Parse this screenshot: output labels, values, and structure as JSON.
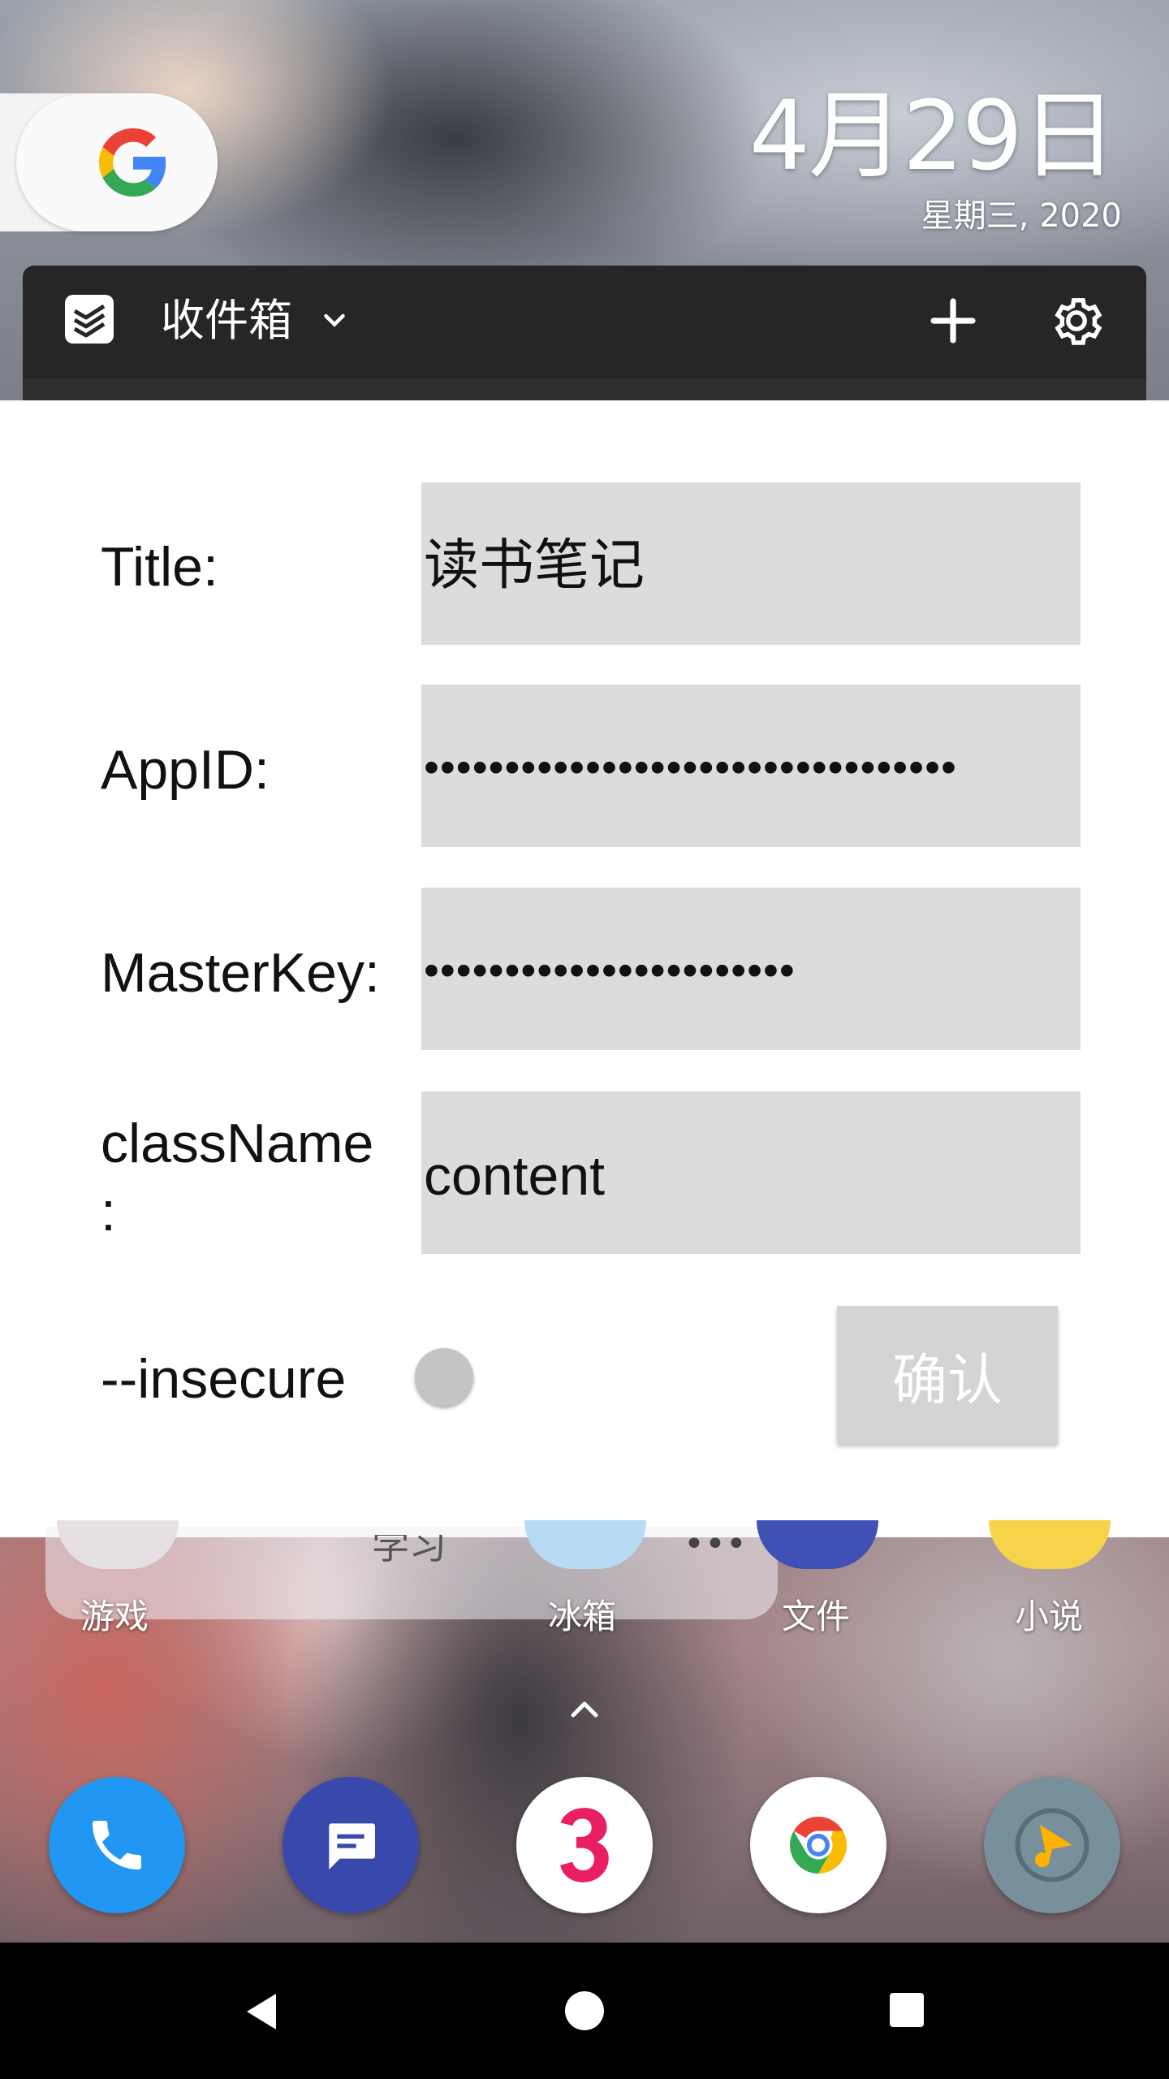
{
  "launcher": {
    "date": "4月29日",
    "weekday_year": "星期三, 2020"
  },
  "widget": {
    "list_name": "收件箱"
  },
  "form": {
    "title_label": "Title:",
    "title_value": "读书笔记",
    "appid_label": "AppID:",
    "appid_value": "•••••••••••••••••••••••••••••••••",
    "masterkey_label": "MasterKey:",
    "masterkey_value": "•••••••••••••••••••••••",
    "classname_label_line1": "className",
    "classname_label_line2": ":",
    "classname_value": "content",
    "insecure_label": "--insecure",
    "insecure_enabled": false,
    "confirm_label": "确认"
  },
  "home_row": {
    "folder_title": "学习",
    "more_indicator": "•••",
    "apps": [
      {
        "label": "游戏"
      },
      {
        "label": "冰箱"
      },
      {
        "label": "文件"
      },
      {
        "label": "小说"
      }
    ]
  },
  "dock": [
    {
      "icon": "phone-icon",
      "color": "#2196F3"
    },
    {
      "icon": "messages-icon",
      "color": "#3949AB"
    },
    {
      "icon": "app-icon-3",
      "color": "#ffffff"
    },
    {
      "icon": "chrome-icon",
      "color": "#ffffff"
    },
    {
      "icon": "music-icon",
      "color": "#78909C"
    }
  ],
  "colors": {
    "widget_header": "#262626",
    "input_fill": "#dcdcdc",
    "confirm_disabled": "#d4d4d4"
  }
}
